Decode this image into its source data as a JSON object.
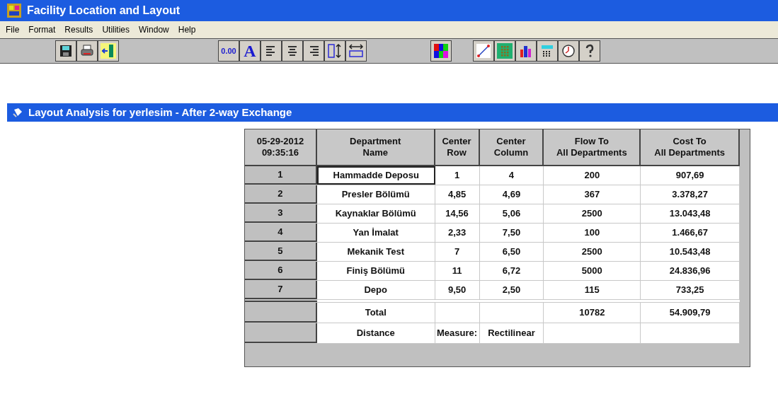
{
  "window": {
    "title": "Facility Location and Layout"
  },
  "menu": [
    "File",
    "Format",
    "Results",
    "Utilities",
    "Window",
    "Help"
  ],
  "toolbar": [
    {
      "kind": "floppy"
    },
    {
      "kind": "printer"
    },
    {
      "kind": "exit"
    },
    {
      "kind": "text",
      "label": "0.00"
    },
    {
      "kind": "letter",
      "label": "A"
    },
    {
      "kind": "align-left"
    },
    {
      "kind": "align-center"
    },
    {
      "kind": "align-right"
    },
    {
      "kind": "row-height"
    },
    {
      "kind": "col-width"
    },
    {
      "kind": "colors"
    },
    {
      "kind": "line-chart"
    },
    {
      "kind": "grid"
    },
    {
      "kind": "bar-chart"
    },
    {
      "kind": "calculator"
    },
    {
      "kind": "clock"
    },
    {
      "kind": "help"
    }
  ],
  "child_window": {
    "title": "Layout Analysis for yerlesim - After 2-way Exchange"
  },
  "table": {
    "corner": "05-29-2012\n09:35:16",
    "columns": [
      "Department\nName",
      "Center\nRow",
      "Center\nColumn",
      "Flow To\nAll Departments",
      "Cost To\nAll Departments"
    ],
    "rows": [
      {
        "index": "1",
        "focused": true,
        "cells": [
          "Hammadde Deposu",
          "1",
          "4",
          "200",
          "907,69"
        ]
      },
      {
        "index": "2",
        "focused": false,
        "cells": [
          "Presler Bölümü",
          "4,85",
          "4,69",
          "367",
          "3.378,27"
        ]
      },
      {
        "index": "3",
        "focused": false,
        "cells": [
          "Kaynaklar Bölümü",
          "14,56",
          "5,06",
          "2500",
          "13.043,48"
        ]
      },
      {
        "index": "4",
        "focused": false,
        "cells": [
          "Yan İmalat",
          "2,33",
          "7,50",
          "100",
          "1.466,67"
        ]
      },
      {
        "index": "5",
        "focused": false,
        "cells": [
          "Mekanik Test",
          "7",
          "6,50",
          "2500",
          "10.543,48"
        ]
      },
      {
        "index": "6",
        "focused": false,
        "cells": [
          "Finiş Bölümü",
          "11",
          "6,72",
          "5000",
          "24.836,96"
        ]
      },
      {
        "index": "7",
        "focused": false,
        "cells": [
          "Depo",
          "9,50",
          "2,50",
          "115",
          "733,25"
        ]
      }
    ],
    "footer": [
      {
        "cells": [
          "Total",
          null,
          null,
          "10782",
          "54.909,79"
        ]
      },
      {
        "cells": [
          "Distance",
          "Measure:",
          "Rectilinear",
          null,
          null
        ]
      }
    ]
  }
}
